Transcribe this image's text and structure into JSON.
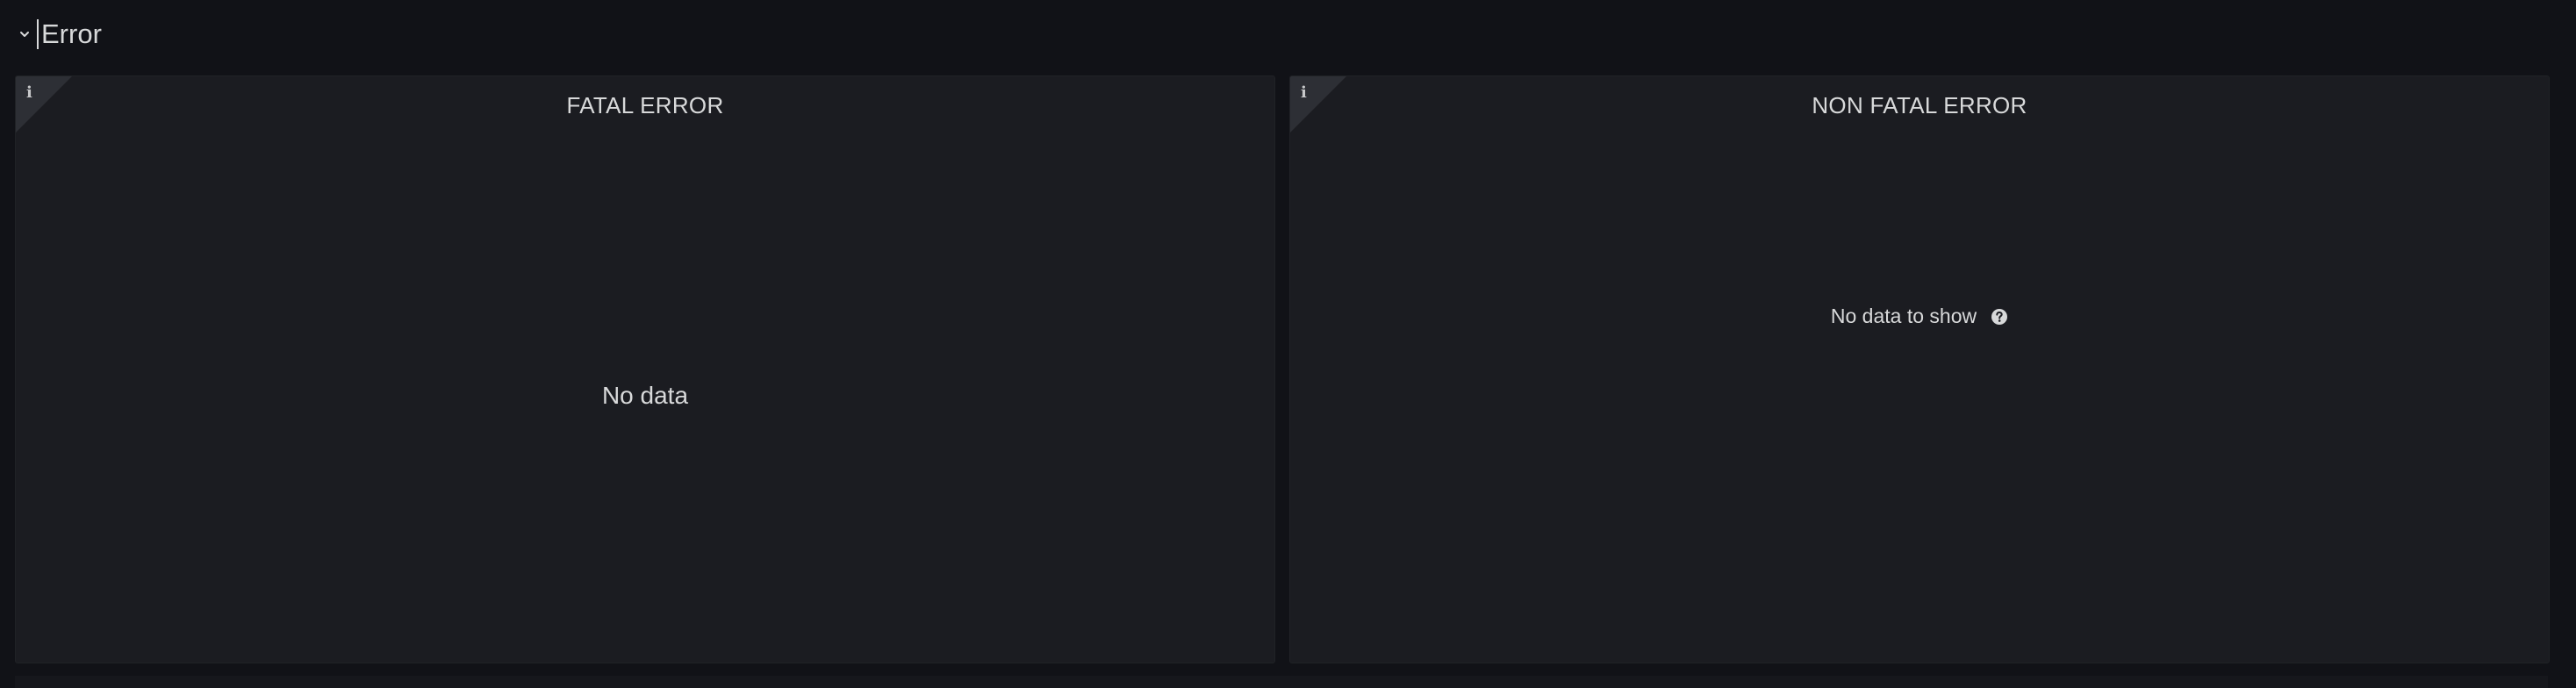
{
  "row": {
    "title": "Error",
    "chevron_icon": "chevron-down-icon"
  },
  "panels": [
    {
      "title": "FATAL ERROR",
      "info_icon": "info-icon",
      "empty_text": "No data"
    },
    {
      "title": "NON FATAL ERROR",
      "info_icon": "info-icon",
      "empty_text": "No data to show",
      "help_icon": "question-circle-icon"
    }
  ],
  "colors": {
    "background": "#111217",
    "panel": "#1b1c21",
    "text": "#d8d9da"
  }
}
